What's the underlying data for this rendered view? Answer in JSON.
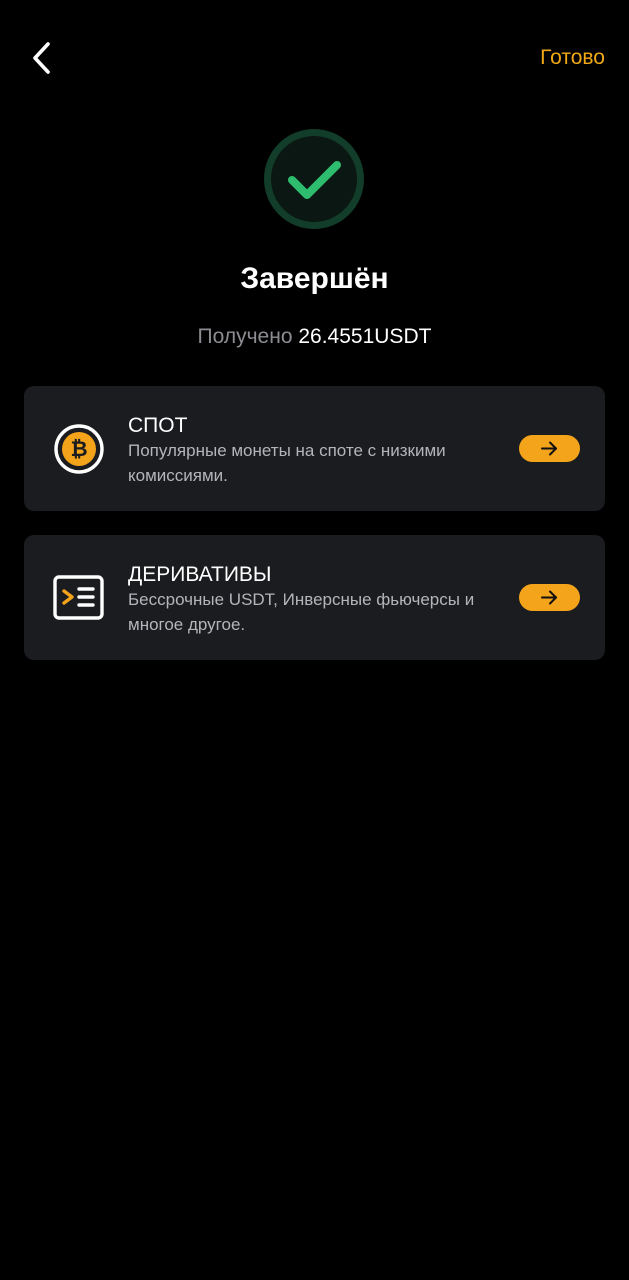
{
  "header": {
    "back_icon": "chevron-left-icon",
    "done_label": "Готово"
  },
  "status": {
    "icon": "check-circle-icon",
    "title": "Завершён",
    "received_label": "Получено",
    "received_amount": "26.4551USDT"
  },
  "cards": [
    {
      "icon": "bitcoin-icon",
      "title": "СПОТ",
      "description": "Популярные монеты на споте с низкими комиссиями.",
      "arrow_icon": "arrow-right-icon"
    },
    {
      "icon": "terminal-list-icon",
      "title": "ДЕРИВАТИВЫ",
      "description": "Бессрочные USDT, Инверсные фьючерсы и многое другое.",
      "arrow_icon": "arrow-right-icon"
    }
  ],
  "colors": {
    "background": "#000000",
    "card": "#1b1c1f",
    "accent": "#f4a41a",
    "success": "#2ebd6e",
    "muted_text": "#8b8d92"
  }
}
